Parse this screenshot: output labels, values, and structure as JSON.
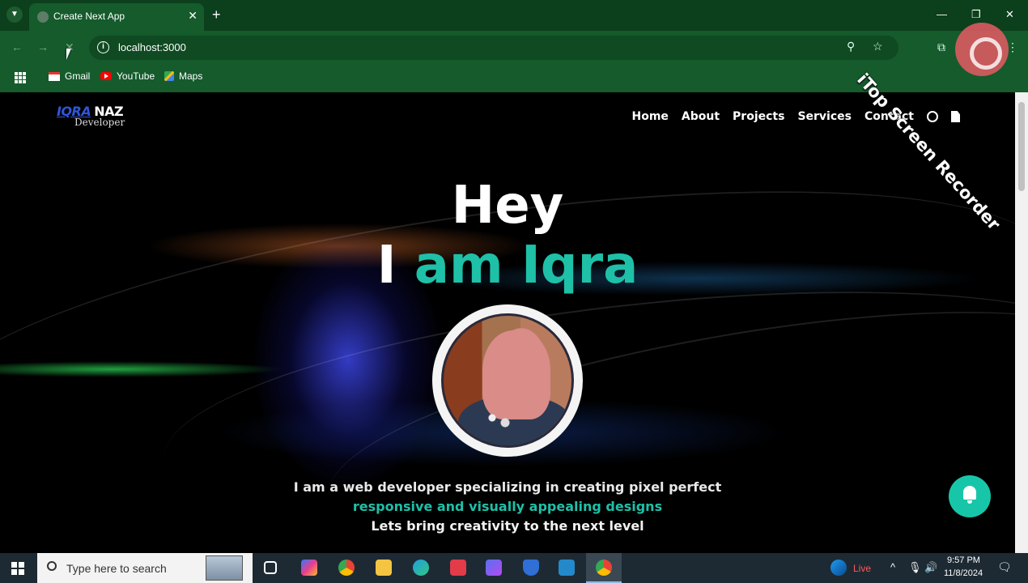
{
  "browser": {
    "tab_title": "Create Next App",
    "url": "localhost:3000",
    "bookmarks": [
      {
        "label": "Gmail",
        "icon": "gmail-icon"
      },
      {
        "label": "YouTube",
        "icon": "youtube-icon"
      },
      {
        "label": "Maps",
        "icon": "maps-icon"
      }
    ]
  },
  "site": {
    "logo": {
      "first": "IQRA",
      "second": "NAZ",
      "sub": "Developer"
    },
    "nav": [
      "Home",
      "About",
      "Projects",
      "Services",
      "Contact"
    ],
    "hero": {
      "line1": "Hey",
      "line2_white": "I",
      "line2_teal": "am Iqra"
    },
    "tagline": {
      "line1": "I am a web developer specializing in creating pixel perfect",
      "line2": "responsive and visually appealing designs",
      "line3": "Lets bring creativity to the next level"
    },
    "colors": {
      "accent": "#1ec0a8",
      "logo_blue": "#2f56d8"
    }
  },
  "watermark": {
    "text": "iTop Screen Recorder"
  },
  "taskbar": {
    "search_placeholder": "Type here to search",
    "live_label": "Live",
    "time": "9:57 PM",
    "date": "11/8/2024"
  }
}
